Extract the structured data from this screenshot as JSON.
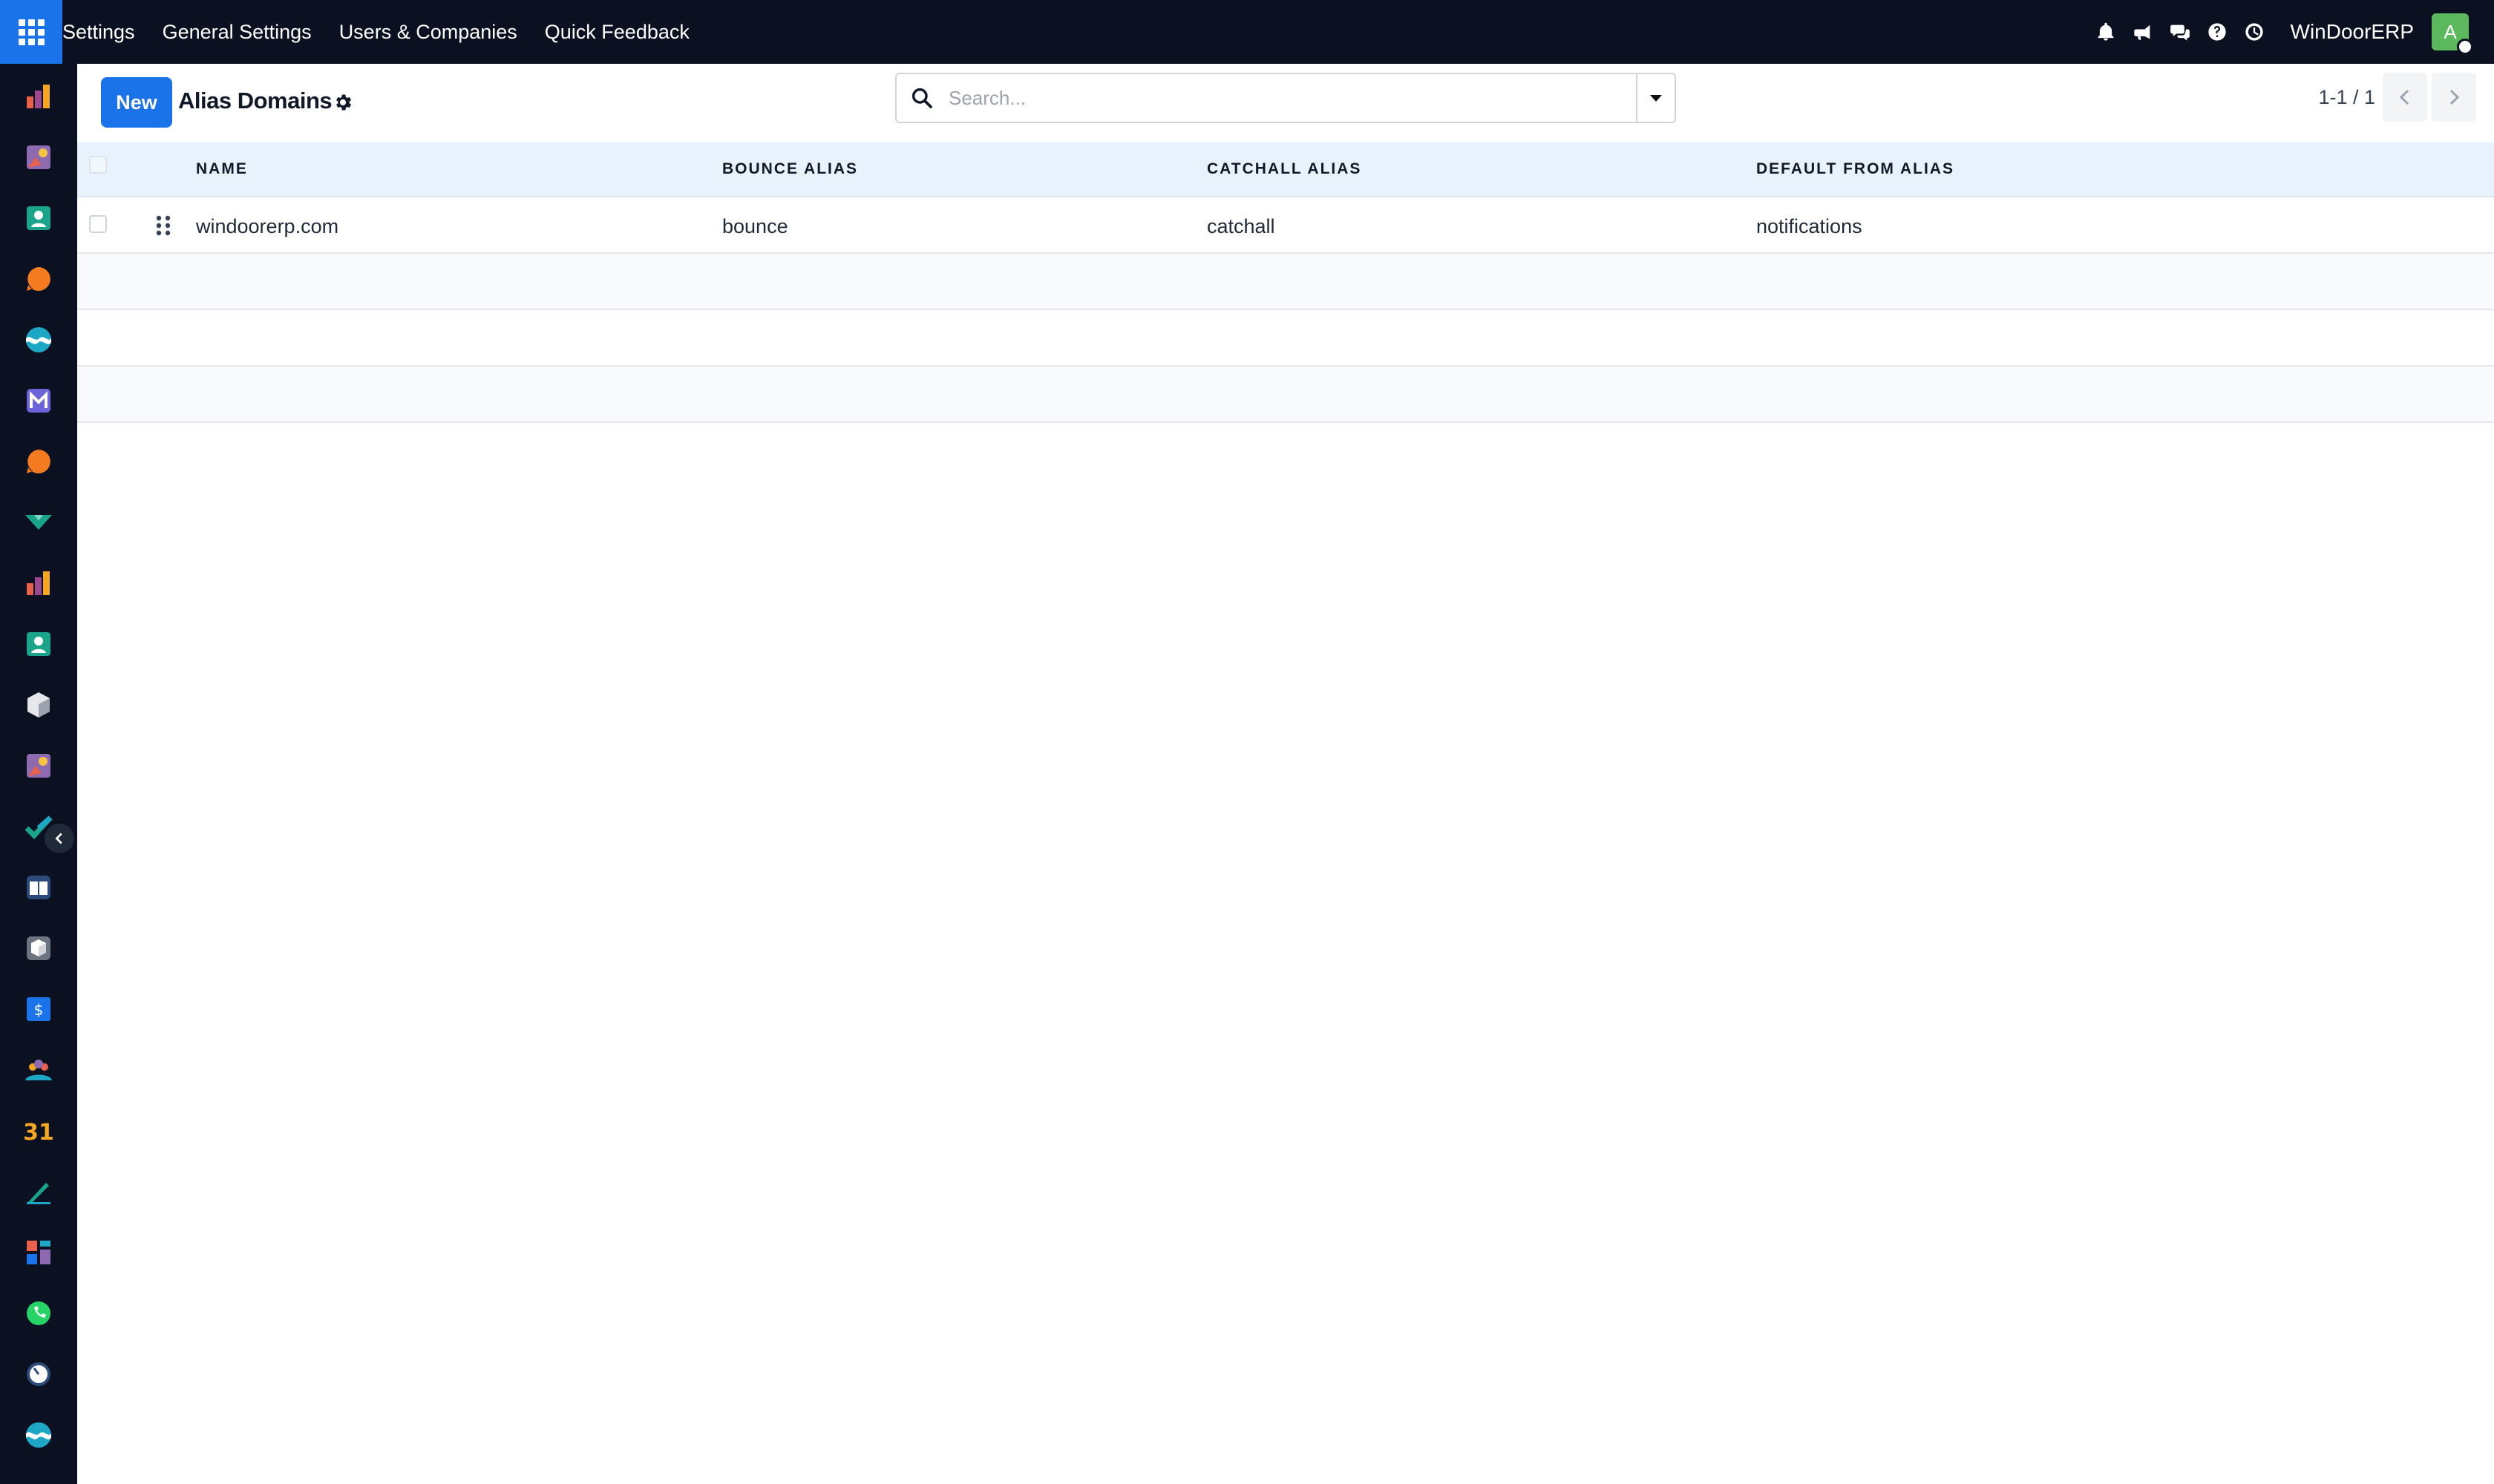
{
  "topbar": {
    "menu": [
      "Settings",
      "General Settings",
      "Users & Companies",
      "Quick Feedback"
    ],
    "company": "WinDoorERP",
    "avatar_letter": "A"
  },
  "control": {
    "new_label": "New",
    "title": "Alias Domains",
    "search_placeholder": "Search...",
    "pager": "1-1 / 1"
  },
  "table": {
    "columns": [
      "NAME",
      "BOUNCE ALIAS",
      "CATCHALL ALIAS",
      "DEFAULT FROM ALIAS"
    ],
    "rows": [
      {
        "name": "windoorerp.com",
        "bounce": "bounce",
        "catchall": "catchall",
        "default_from": "notifications"
      }
    ]
  },
  "colors": {
    "brand": "#1a73e8",
    "topbar_bg": "#0b1120",
    "header_bg": "#e8f2fd"
  },
  "sidebar_icons": [
    "analytics-app-icon",
    "canvas-app-icon",
    "contacts-app-icon",
    "discuss-app-icon",
    "wave-app-icon",
    "mail-app-icon",
    "chat-app-icon",
    "marketing-app-icon",
    "reports-app-icon",
    "employees-app-icon",
    "inventory-app-icon",
    "studio-app-icon",
    "tasks-app-icon",
    "knowledge-app-icon",
    "package-app-icon",
    "sales-app-icon",
    "team-app-icon",
    "calendar-app-icon",
    "sign-app-icon",
    "dashboards-app-icon",
    "whatsapp-app-icon",
    "timer-app-icon",
    "website-app-icon"
  ]
}
